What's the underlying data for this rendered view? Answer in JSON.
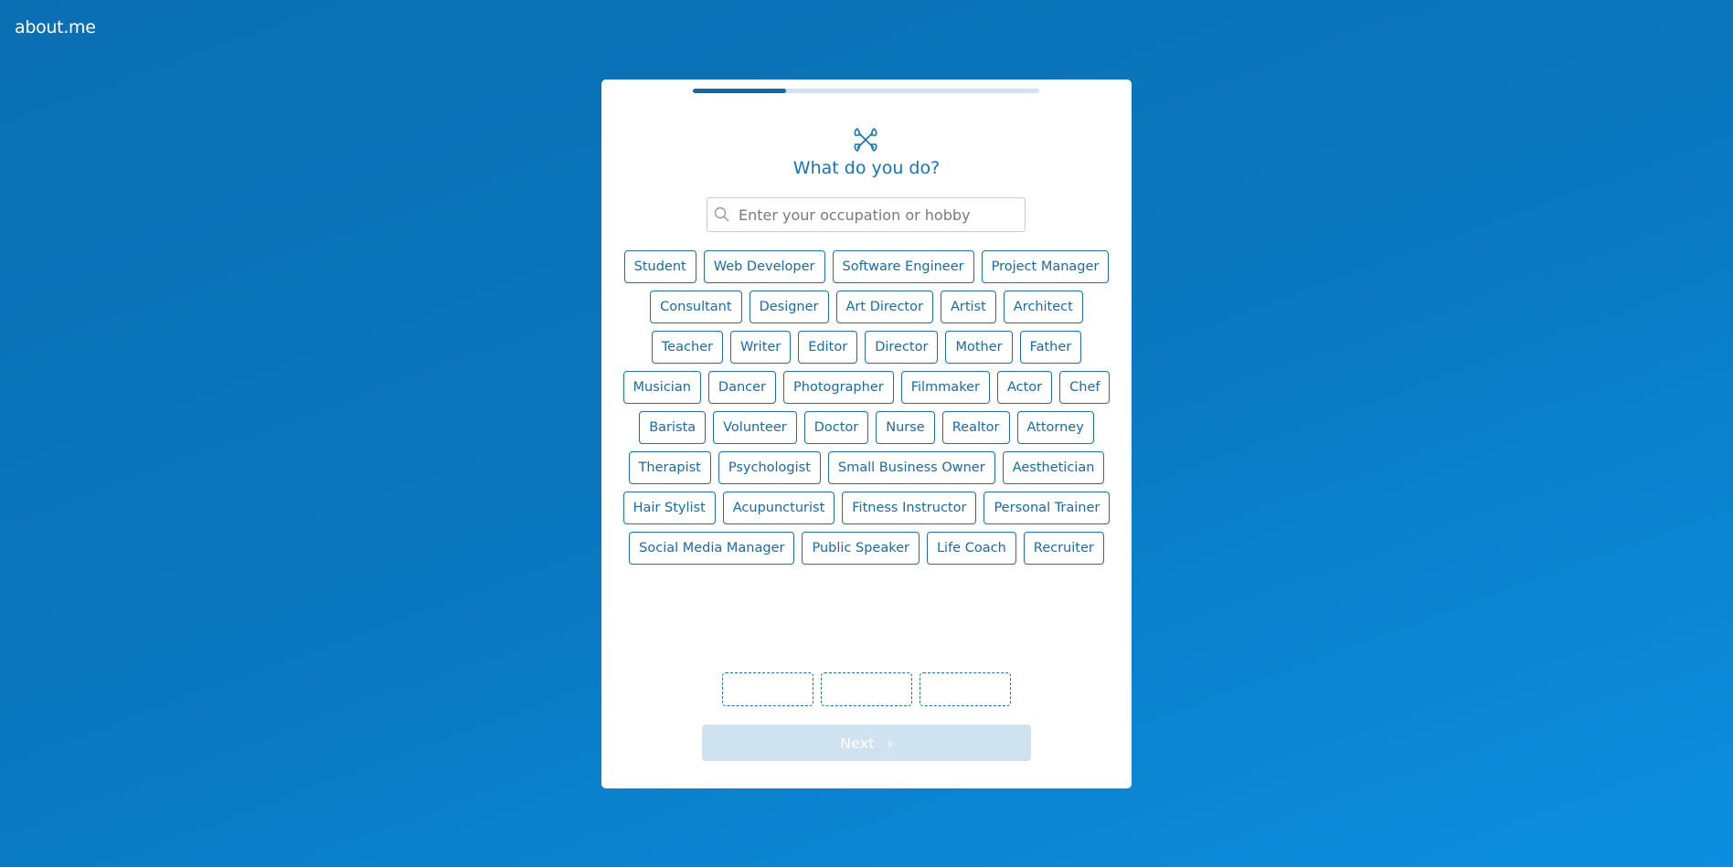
{
  "logo": "about.me",
  "progress": {
    "percent": 27,
    "fill_color": "#0f6aa8"
  },
  "title": "What do you do?",
  "search": {
    "placeholder": "Enter your occupation or hobby",
    "value": ""
  },
  "chip_rows": [
    [
      "Student",
      "Web Developer",
      "Software Engineer",
      "Project Manager"
    ],
    [
      "Consultant",
      "Designer",
      "Art Director",
      "Artist",
      "Architect"
    ],
    [
      "Teacher",
      "Writer",
      "Editor",
      "Director",
      "Mother",
      "Father"
    ],
    [
      "Musician",
      "Dancer",
      "Photographer",
      "Filmmaker",
      "Actor",
      "Chef"
    ],
    [
      "Barista",
      "Volunteer",
      "Doctor",
      "Nurse",
      "Realtor",
      "Attorney"
    ],
    [
      "Therapist",
      "Psychologist",
      "Small Business Owner",
      "Aesthetician"
    ],
    [
      "Hair Stylist",
      "Acupuncturist",
      "Fitness Instructor",
      "Personal Trainer"
    ],
    [
      "Social Media Manager",
      "Public Speaker",
      "Life Coach",
      "Recruiter"
    ]
  ],
  "slots_count": 3,
  "next": {
    "label": "Next",
    "icon": "chevron-right-icon",
    "disabled": true
  },
  "colors": {
    "accent": "#1673b4",
    "background": "#0a78c0"
  }
}
